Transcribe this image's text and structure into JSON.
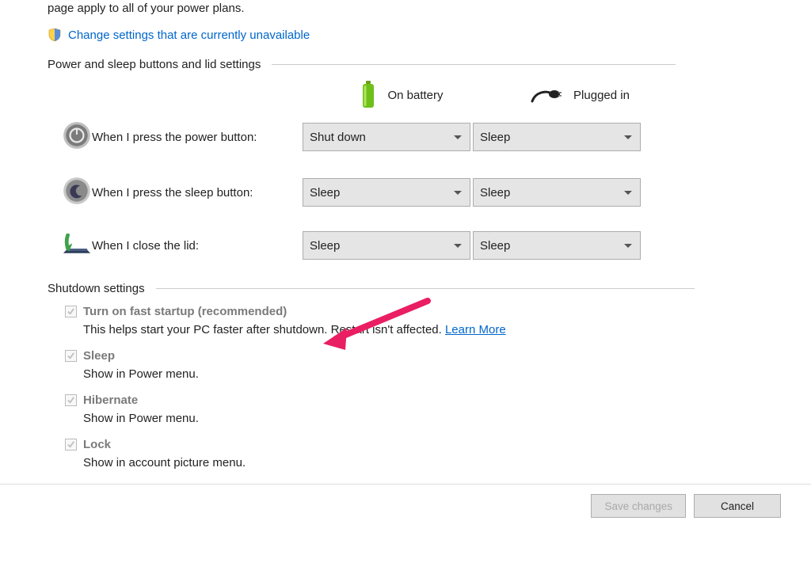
{
  "intro": "page apply to all of your power plans.",
  "change_link": "Change settings that are currently unavailable",
  "section_power_lid": "Power and sleep buttons and lid settings",
  "columns": {
    "battery": "On battery",
    "plugged": "Plugged in"
  },
  "rows": {
    "power_button": {
      "label": "When I press the power button:",
      "battery": "Shut down",
      "plugged": "Sleep"
    },
    "sleep_button": {
      "label": "When I press the sleep button:",
      "battery": "Sleep",
      "plugged": "Sleep"
    },
    "lid": {
      "label": "When I close the lid:",
      "battery": "Sleep",
      "plugged": "Sleep"
    }
  },
  "section_shutdown": "Shutdown settings",
  "shutdown": {
    "fast_startup": {
      "label": "Turn on fast startup (recommended)",
      "desc": "This helps start your PC faster after shutdown. Restart isn't affected. ",
      "learn_more": "Learn More"
    },
    "sleep": {
      "label": "Sleep",
      "desc": "Show in Power menu."
    },
    "hibernate": {
      "label": "Hibernate",
      "desc": "Show in Power menu."
    },
    "lock": {
      "label": "Lock",
      "desc": "Show in account picture menu."
    }
  },
  "buttons": {
    "save": "Save changes",
    "cancel": "Cancel"
  }
}
